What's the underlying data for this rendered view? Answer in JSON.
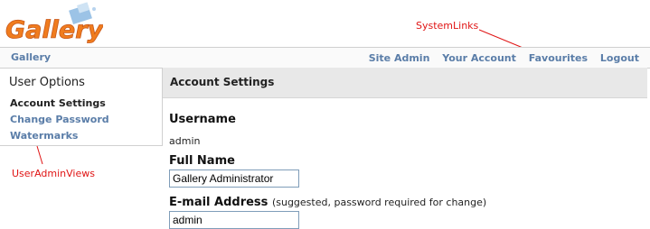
{
  "header": {
    "logo_text": "Gallery",
    "breadcrumb": "Gallery"
  },
  "system_links": [
    {
      "label": "Site Admin"
    },
    {
      "label": "Your Account"
    },
    {
      "label": "Favourites"
    },
    {
      "label": "Logout"
    }
  ],
  "annotations": {
    "system_links": "SystemLinks",
    "user_admin_views": "UserAdminViews"
  },
  "sidebar": {
    "title": "User Options",
    "items": [
      {
        "label": "Account Settings",
        "current": true
      },
      {
        "label": "Change Password",
        "current": false
      },
      {
        "label": "Watermarks",
        "current": false
      }
    ]
  },
  "main": {
    "title": "Account Settings",
    "username_label": "Username",
    "username_value": "admin",
    "fullname_label": "Full Name",
    "fullname_value": "Gallery Administrator",
    "email_label": "E-mail Address",
    "email_hint": "(suggested, password required for change)",
    "email_value": "admin"
  },
  "colors": {
    "link": "#5a7da8",
    "annotation": "#e01515",
    "logo": "#f07c1e"
  }
}
